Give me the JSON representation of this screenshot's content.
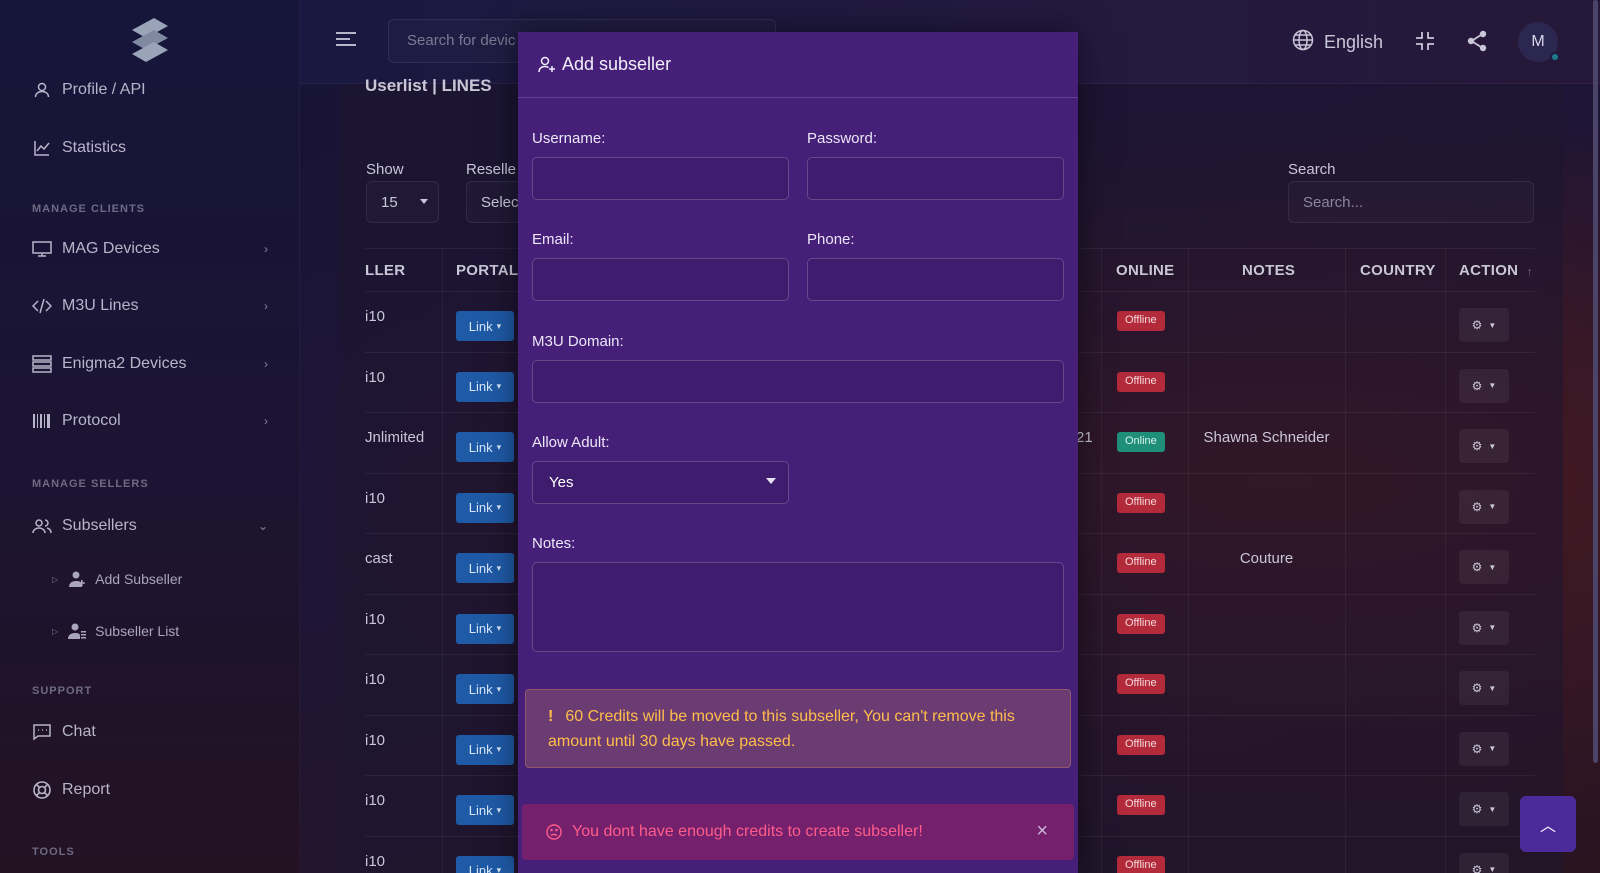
{
  "sidebar": {
    "items": [
      {
        "label": "Profile / API",
        "icon": "user-icon"
      },
      {
        "label": "Statistics",
        "icon": "chart-line-icon"
      }
    ],
    "section_manage_clients": "MANAGE CLIENTS",
    "clients": [
      {
        "label": "MAG Devices",
        "icon": "monitor-icon"
      },
      {
        "label": "M3U Lines",
        "icon": "code-icon"
      },
      {
        "label": "Enigma2 Devices",
        "icon": "server-icon"
      },
      {
        "label": "Protocol",
        "icon": "barcode-icon"
      }
    ],
    "section_manage_sellers": "MANAGE SELLERS",
    "subsellers_label": "Subsellers",
    "sub_items": [
      {
        "label": "Add Subseller",
        "icon": "user-plus-icon"
      },
      {
        "label": "Subseller List",
        "icon": "user-list-icon"
      }
    ],
    "section_support": "SUPPORT",
    "support": [
      {
        "label": "Chat",
        "icon": "chat-icon"
      },
      {
        "label": "Report",
        "icon": "lifebuoy-icon"
      }
    ],
    "section_tools": "TOOLS"
  },
  "topbar": {
    "search_placeholder": "Search for devic",
    "language": "English",
    "avatar_initial": "M"
  },
  "main": {
    "title": "Userlist | LINES",
    "show_label": "Show",
    "show_value": "15",
    "reseller_label": "Reselle",
    "reseller_value": "Selec",
    "search_label": "Search",
    "search_placeholder": "Search...",
    "columns": [
      "LLER",
      "PORTAL",
      "ONLINE",
      "NOTES",
      "COUNTRY",
      "ACTION"
    ],
    "link_label": "Link",
    "rows": [
      {
        "seller": "i10",
        "status": "Offline",
        "note": ""
      },
      {
        "seller": "i10",
        "status": "Offline",
        "note": ""
      },
      {
        "seller": "Jnlimited",
        "status": "Online",
        "note": "Shawna Schneider",
        "extra": "21"
      },
      {
        "seller": "i10",
        "status": "Offline",
        "note": ""
      },
      {
        "seller": "cast",
        "status": "Offline",
        "note": "Couture"
      },
      {
        "seller": "i10",
        "status": "Offline",
        "note": ""
      },
      {
        "seller": "i10",
        "status": "Offline",
        "note": ""
      },
      {
        "seller": "i10",
        "status": "Offline",
        "note": ""
      },
      {
        "seller": "i10",
        "status": "Offline",
        "note": ""
      },
      {
        "seller": "i10",
        "status": "Offline",
        "note": ""
      }
    ]
  },
  "modal": {
    "title": "Add subseller",
    "username_label": "Username:",
    "password_label": "Password:",
    "email_label": "Email:",
    "phone_label": "Phone:",
    "m3u_label": "M3U Domain:",
    "adult_label": "Allow Adult:",
    "adult_value": "Yes",
    "notes_label": "Notes:",
    "warning": "60 Credits will be moved to this subseller, You can't remove this amount until 30 days have passed.",
    "warning_mark": "!",
    "error": "You dont have enough credits to create subseller!",
    "close_glyph": "×"
  },
  "colors": {
    "modal_bg": "#461f79",
    "warning_text": "#ffbd4a",
    "error_text": "#ff5c8a",
    "offline_badge": "#b32a3a",
    "online_badge": "#1f8f7a",
    "link_button": "#1f5aa6"
  }
}
